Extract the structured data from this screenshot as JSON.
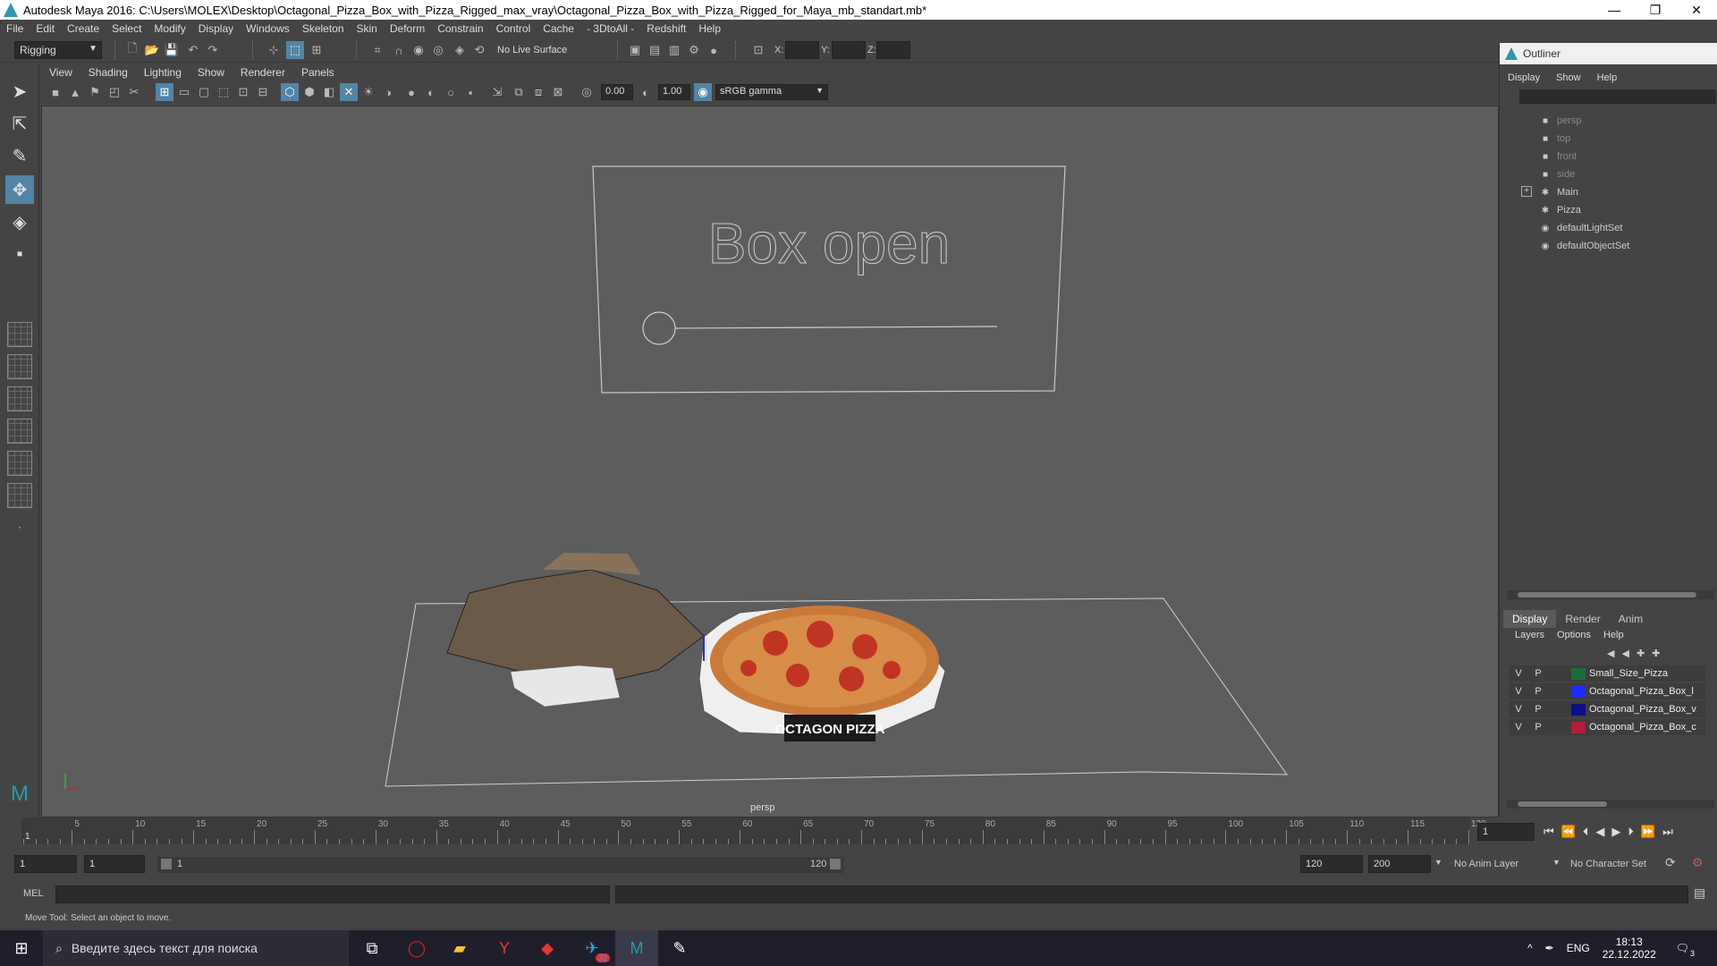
{
  "window": {
    "title": "Autodesk Maya 2016: C:\\Users\\MOLEX\\Desktop\\Octagonal_Pizza_Box_with_Pizza_Rigged_max_vray\\Octagonal_Pizza_Box_with_Pizza_Rigged_for_Maya_mb_standart.mb*",
    "minimize": "—",
    "restore": "❐",
    "close": "✕"
  },
  "menubar": [
    "File",
    "Edit",
    "Create",
    "Select",
    "Modify",
    "Display",
    "Windows",
    "Skeleton",
    "Skin",
    "Deform",
    "Constrain",
    "Control",
    "Cache",
    "- 3DtoAll -",
    "Redshift",
    "Help"
  ],
  "toolbar": {
    "mode": "Rigging",
    "live_surface": "No Live Surface",
    "x_label": "X:",
    "y_label": "Y:",
    "z_label": "Z:"
  },
  "panel": {
    "menus": [
      "View",
      "Shading",
      "Lighting",
      "Show",
      "Renderer",
      "Panels"
    ],
    "exposure": "0.00",
    "gamma": "1.00",
    "colorspace": "sRGB gamma",
    "camera": "persp"
  },
  "viewport": {
    "control_text": "Box open",
    "box_label": "OCTAGON PIZZA"
  },
  "outliner": {
    "title": "Outliner",
    "menus": [
      "Display",
      "Show",
      "Help"
    ],
    "items": [
      {
        "label": "persp",
        "dim": true,
        "icon": "camera-icon"
      },
      {
        "label": "top",
        "dim": true,
        "icon": "camera-icon"
      },
      {
        "label": "front",
        "dim": true,
        "icon": "camera-icon"
      },
      {
        "label": "side",
        "dim": true,
        "icon": "camera-icon"
      },
      {
        "label": "Main",
        "dim": false,
        "icon": "joint-icon"
      },
      {
        "label": "Pizza",
        "dim": false,
        "icon": "joint-icon"
      },
      {
        "label": "defaultLightSet",
        "dim": false,
        "icon": "set-icon"
      },
      {
        "label": "defaultObjectSet",
        "dim": false,
        "icon": "set-icon"
      }
    ]
  },
  "layers": {
    "tabs": [
      "Display",
      "Render",
      "Anim"
    ],
    "menus": [
      "Layers",
      "Options",
      "Help"
    ],
    "rows": [
      {
        "v": "V",
        "p": "P",
        "color": "#1f6b3a",
        "name": "Small_Size_Pizza"
      },
      {
        "v": "V",
        "p": "P",
        "color": "#1c2cff",
        "name": "Octagonal_Pizza_Box_l"
      },
      {
        "v": "V",
        "p": "P",
        "color": "#0e0e8a",
        "name": "Octagonal_Pizza_Box_v"
      },
      {
        "v": "V",
        "p": "P",
        "color": "#b0203a",
        "name": "Octagonal_Pizza_Box_c"
      }
    ]
  },
  "timeline": {
    "labels": [
      "5",
      "10",
      "15",
      "20",
      "25",
      "30",
      "35",
      "40",
      "45",
      "50",
      "55",
      "60",
      "65",
      "70",
      "75",
      "80",
      "85",
      "90",
      "95",
      "100",
      "105",
      "110",
      "115",
      "120"
    ],
    "start_marker": "1",
    "current_frame": "1"
  },
  "range": {
    "start": "1",
    "playback_start": "1",
    "slider_start": "1",
    "slider_end": "120",
    "playback_end": "120",
    "end": "200",
    "anim_layer": "No Anim Layer",
    "char_set": "No Character Set"
  },
  "cmd": {
    "label": "MEL"
  },
  "help": "Move Tool: Select an object to move.",
  "taskbar": {
    "search": "Введите здесь текст для поиска",
    "lang": "ENG",
    "time": "18:13",
    "date": "22.12.2022",
    "notif": "3",
    "telegram_badge": "32"
  }
}
